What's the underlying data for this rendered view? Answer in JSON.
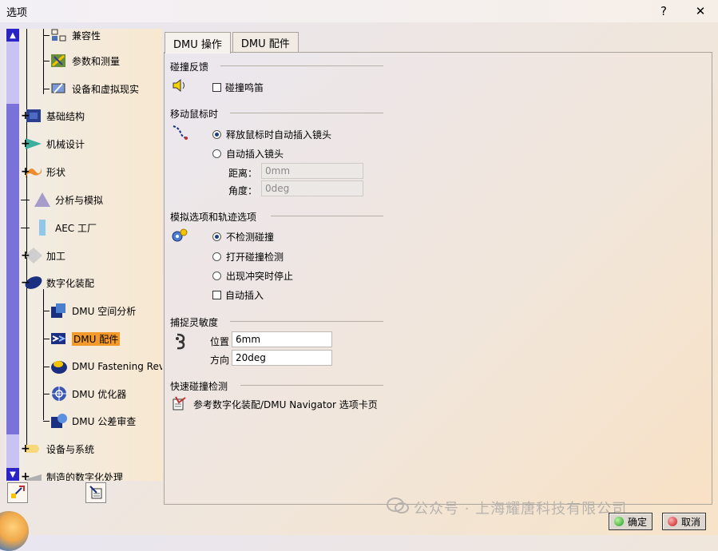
{
  "window": {
    "title": "选项",
    "help_label": "?",
    "close_label": "✕"
  },
  "tree": {
    "items": [
      {
        "label": "兼容性",
        "icon": "compatibility-icon",
        "level": 2
      },
      {
        "label": "参数和测量",
        "icon": "parameters-measure-icon",
        "level": 2
      },
      {
        "label": "设备和虚拟现实",
        "icon": "devices-vr-icon",
        "level": 2
      },
      {
        "label": "基础结构",
        "icon": "infrastructure-icon",
        "level": 1,
        "expander": "+"
      },
      {
        "label": "机械设计",
        "icon": "mechanical-design-icon",
        "level": 1,
        "expander": "+"
      },
      {
        "label": "形状",
        "icon": "shape-icon",
        "level": 1,
        "expander": "+"
      },
      {
        "label": "分析与模拟",
        "icon": "analysis-simulation-icon",
        "level": 1
      },
      {
        "label": "AEC 工厂",
        "icon": "aec-plant-icon",
        "level": 1
      },
      {
        "label": "加工",
        "icon": "machining-icon",
        "level": 1,
        "expander": "+"
      },
      {
        "label": "数字化装配",
        "icon": "digital-mockup-icon",
        "level": 1,
        "expander": "−"
      },
      {
        "label": "DMU 空间分析",
        "icon": "dmu-space-analysis-icon",
        "level": 2
      },
      {
        "label": "DMU 配件",
        "icon": "dmu-fitting-icon",
        "level": 2,
        "selected": true
      },
      {
        "label": "DMU Fastening Revie",
        "icon": "dmu-fastening-icon",
        "level": 2
      },
      {
        "label": "DMU 优化器",
        "icon": "dmu-optimizer-icon",
        "level": 2
      },
      {
        "label": "DMU 公差审查",
        "icon": "dmu-tolerancing-icon",
        "level": 2
      },
      {
        "label": "设备与系统",
        "icon": "equipment-systems-icon",
        "level": 1,
        "expander": "+"
      },
      {
        "label": "制造的数字化处理",
        "icon": "digital-manufacturing-icon",
        "level": 1,
        "expander": "+"
      }
    ],
    "bottom_buttons": [
      "tree-tool-icon",
      "tree-options-icon"
    ]
  },
  "tabs": [
    {
      "label": "DMU 操作",
      "active": true
    },
    {
      "label": "DMU 配件",
      "active": false
    }
  ],
  "groups": {
    "collision_feedback": {
      "title": "碰撞反馈",
      "icon": "speaker-icon",
      "beep_label": "碰撞鸣笛",
      "beep_checked": false
    },
    "move_mouse": {
      "title": "移动鼠标时",
      "icon": "mouse-move-icon",
      "option1": "释放鼠标时自动插入镜头",
      "option2": "自动插入镜头",
      "selected": 1,
      "distance_label": "距离：",
      "distance_value": "0mm",
      "angle_label": "角度：",
      "angle_value": "0deg"
    },
    "simulation": {
      "title": "模拟选项和轨迹选项",
      "icon": "gears-icon",
      "option1": "不检测碰撞",
      "option2": "打开碰撞检测",
      "option3": "出现冲突时停止",
      "selected": 1,
      "auto_insert_label": "自动插入",
      "auto_insert_checked": false
    },
    "snap": {
      "title": "捕捉灵敏度",
      "icon": "snap-icon",
      "position_label": "位置",
      "position_value": "6mm",
      "direction_label": "方向",
      "direction_value": "20deg"
    },
    "quick_clash": {
      "title": "快速碰撞检测",
      "icon": "quick-clash-icon",
      "text": "参考数字化装配/DMU Navigator 选项卡页"
    }
  },
  "footer": {
    "ok_label": "确定",
    "cancel_label": "取消",
    "watermark": "公众号 · 上海耀唐科技有限公司"
  }
}
